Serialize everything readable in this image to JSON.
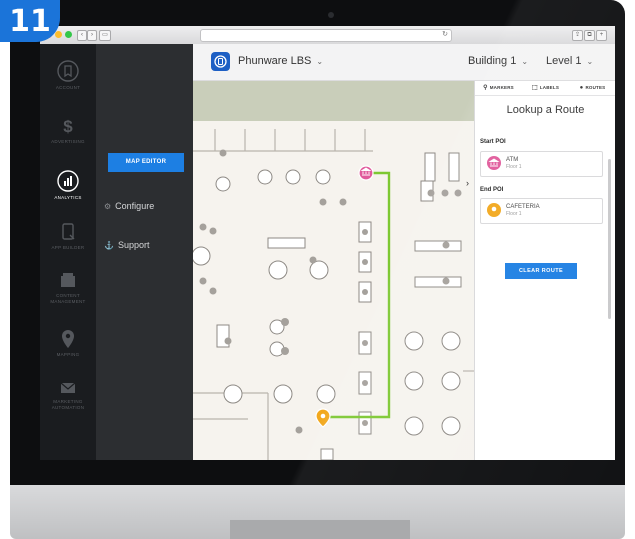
{
  "badge": {
    "number": "11"
  },
  "app": {
    "name": "Phunware LBS",
    "building": "Building 1",
    "level": "Level 1",
    "dropdown_glyph": "⌄"
  },
  "leftnav": {
    "items": [
      {
        "label": "ACCOUNT",
        "icon": "account-icon",
        "active": false
      },
      {
        "label": "ADVERTISING",
        "icon": "dollar-icon",
        "active": false
      },
      {
        "label": "ANALYTICS",
        "icon": "analytics-icon",
        "active": true
      },
      {
        "label": "APP BUILDER",
        "icon": "app-builder-icon",
        "active": false
      },
      {
        "label": "CONTENT MANAGEMENT",
        "icon": "content-icon",
        "active": false
      },
      {
        "label": "MAPPING",
        "icon": "map-pin-icon",
        "active": false
      },
      {
        "label": "MARKETING AUTOMATION",
        "icon": "mail-icon",
        "active": false
      }
    ]
  },
  "submenu": {
    "map_editor": "MAP EDITOR",
    "configure": "Configure",
    "support": "Support"
  },
  "panel": {
    "tabs": [
      {
        "label": "MARKERS",
        "icon": "marker-icon"
      },
      {
        "label": "LABELS",
        "icon": "label-icon"
      },
      {
        "label": "ROUTES",
        "icon": "routes-icon"
      }
    ],
    "title": "Lookup a Route",
    "start_label": "Start POI",
    "start": {
      "name": "ATM",
      "floor": "Floor 1",
      "color": "#e05a9b"
    },
    "end_label": "End POI",
    "end": {
      "name": "CAFETERIA",
      "floor": "Floor 1",
      "color": "#f2a81d"
    },
    "clear_button": "CLEAR ROUTE"
  },
  "colors": {
    "accent": "#1d7fe3",
    "route": "#7dc832",
    "nav_bg": "#1a1c1f",
    "submenu_bg": "#2c2e31"
  }
}
